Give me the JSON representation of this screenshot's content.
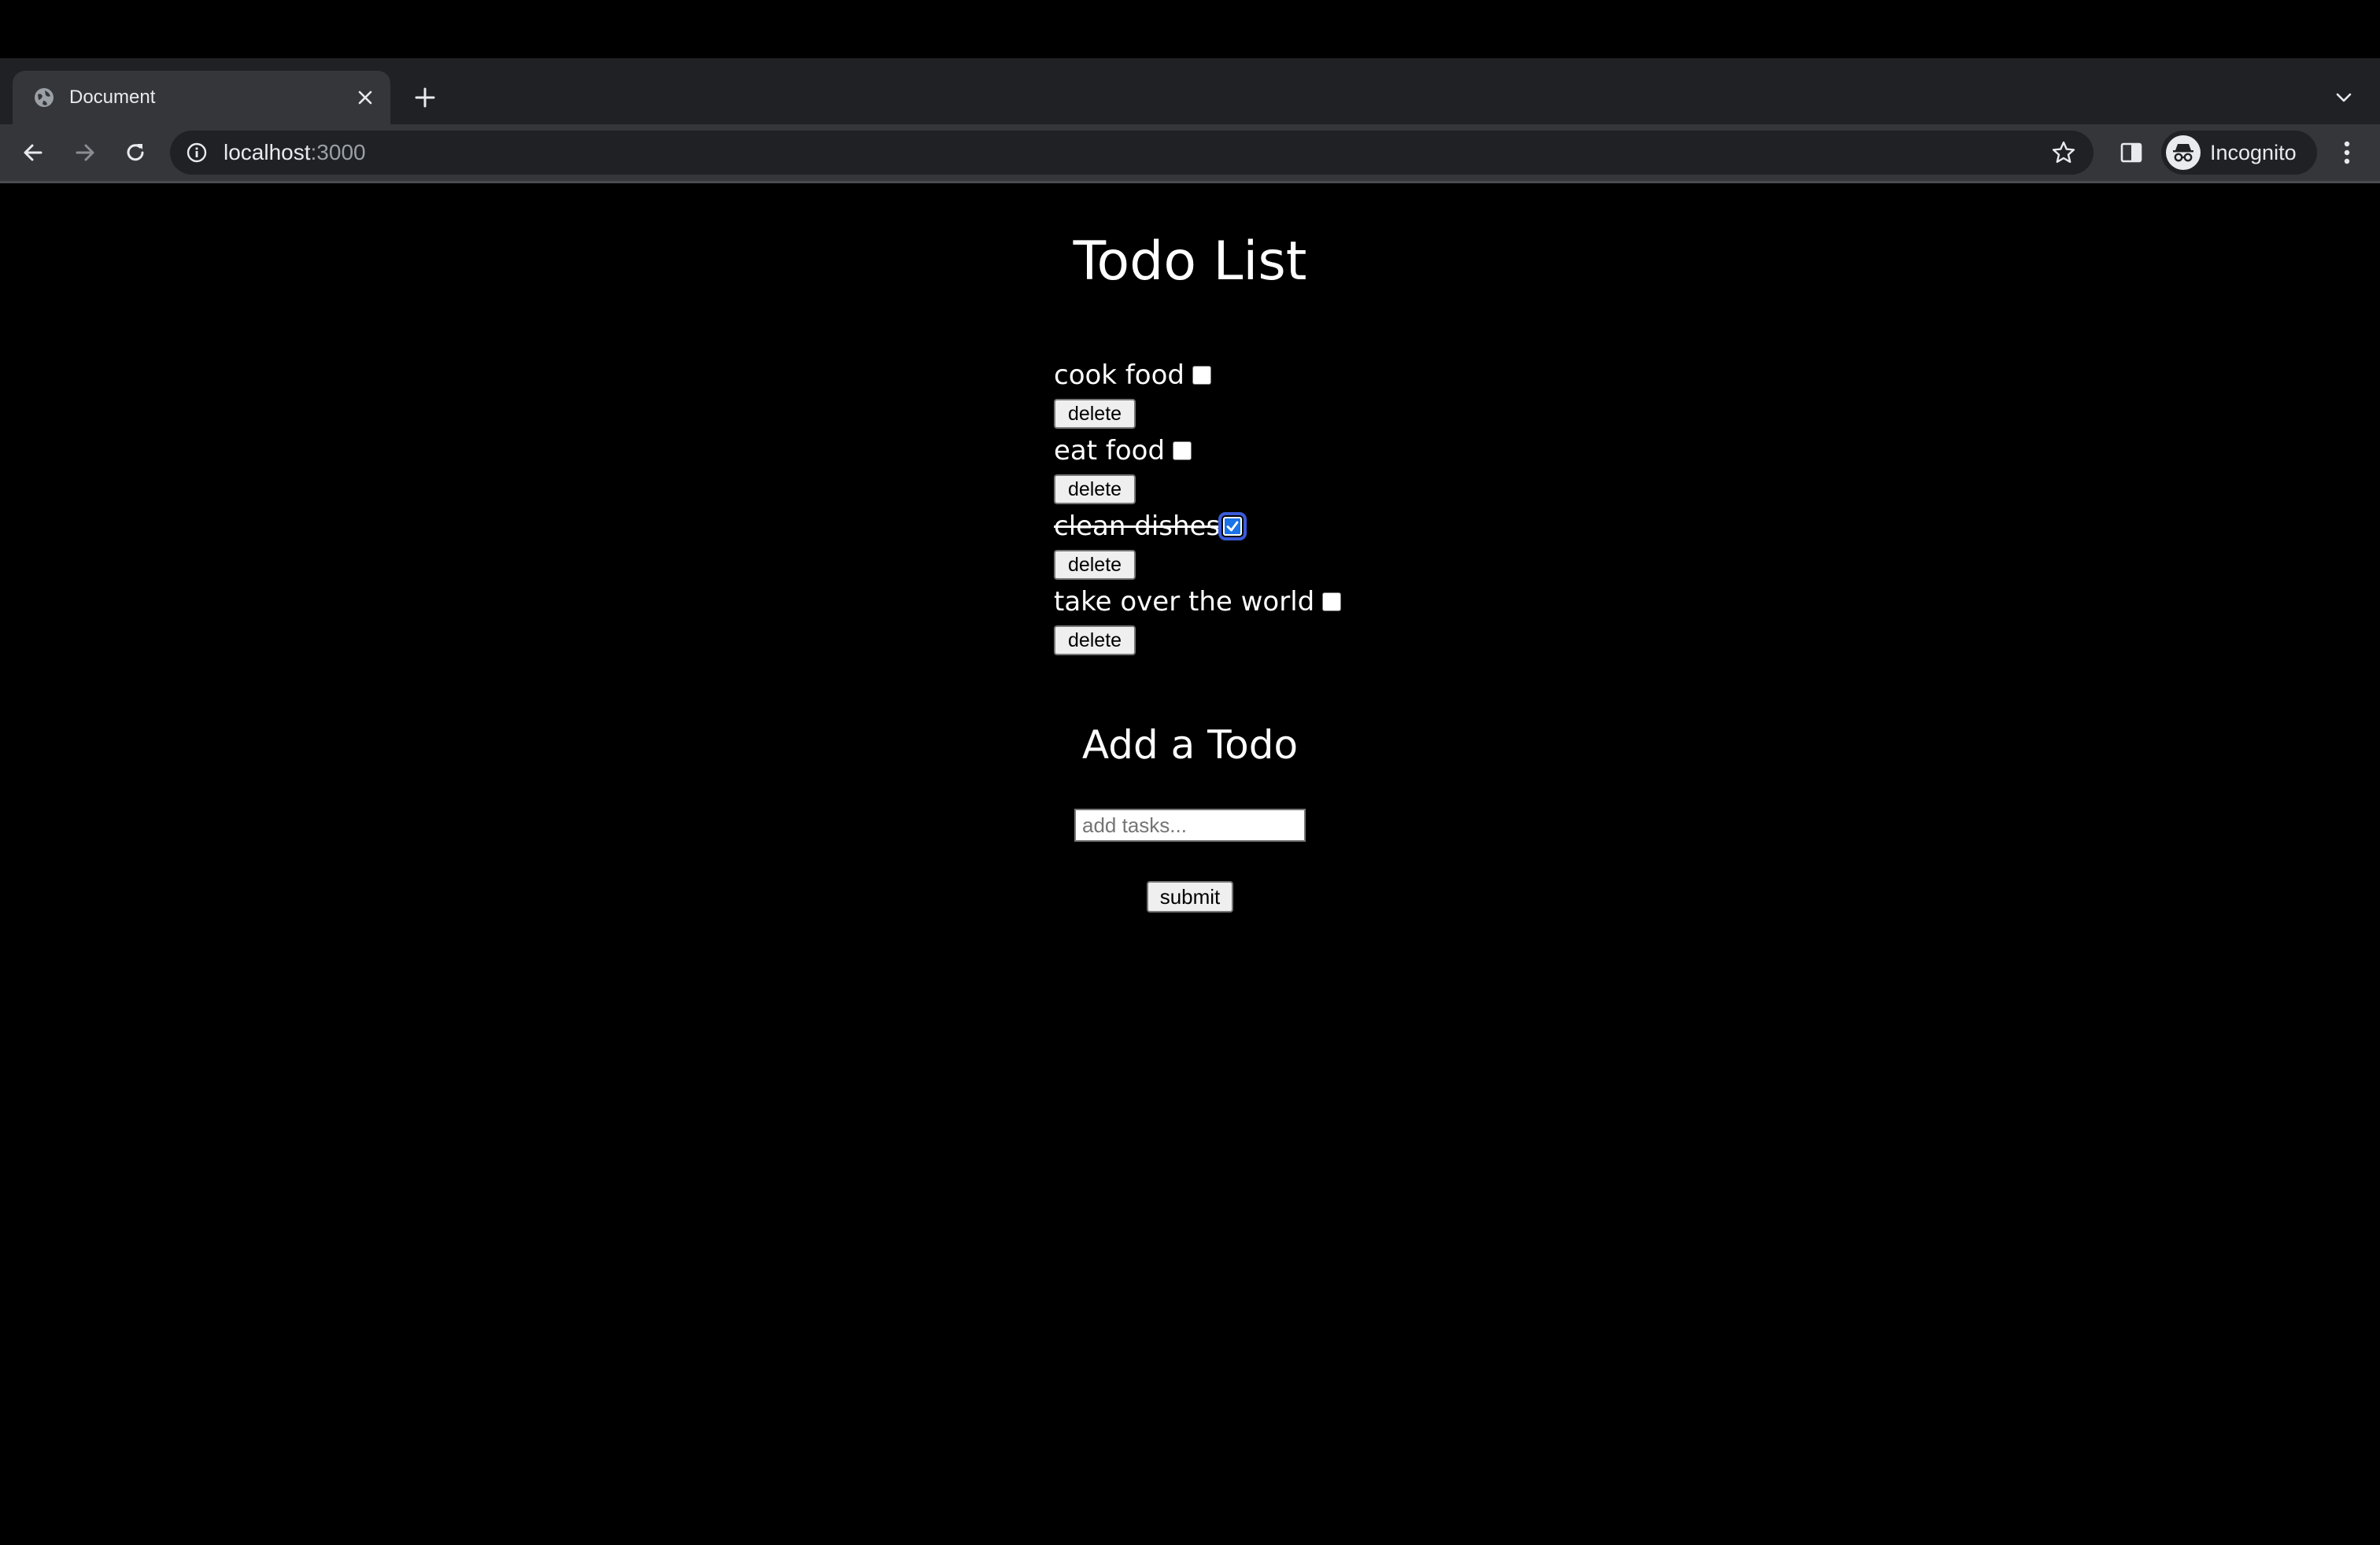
{
  "browser": {
    "tab": {
      "title": "Document",
      "favicon_icon": "globe-icon",
      "close_icon": "close-icon"
    },
    "new_tab_icon": "plus-icon",
    "tab_search_icon": "chevron-down-icon",
    "nav": {
      "back_icon": "arrow-left-icon",
      "forward_icon": "arrow-right-icon",
      "reload_icon": "reload-icon"
    },
    "address_bar": {
      "info_icon": "info-icon",
      "host": "localhost",
      "port": ":3000",
      "bookmark_icon": "star-icon"
    },
    "side_panel_icon": "side-panel-icon",
    "profile": {
      "label": "Incognito",
      "icon": "incognito-icon"
    },
    "menu_icon": "kebab-menu-icon"
  },
  "page": {
    "title": "Todo List",
    "todos": [
      {
        "text": "cook food",
        "done": false,
        "delete_label": "delete"
      },
      {
        "text": "eat food",
        "done": false,
        "delete_label": "delete"
      },
      {
        "text": "clean dishes",
        "done": true,
        "delete_label": "delete"
      },
      {
        "text": "take over the world",
        "done": false,
        "delete_label": "delete"
      }
    ],
    "add_section": {
      "title": "Add a Todo",
      "input_value": "",
      "input_placeholder": "add tasks...",
      "submit_label": "submit"
    }
  },
  "colors": {
    "page_background": "#000000",
    "text": "#ffffff",
    "checkbox_accent": "#1a73e8",
    "tab_strip": "#202124",
    "toolbar": "#35363a"
  }
}
